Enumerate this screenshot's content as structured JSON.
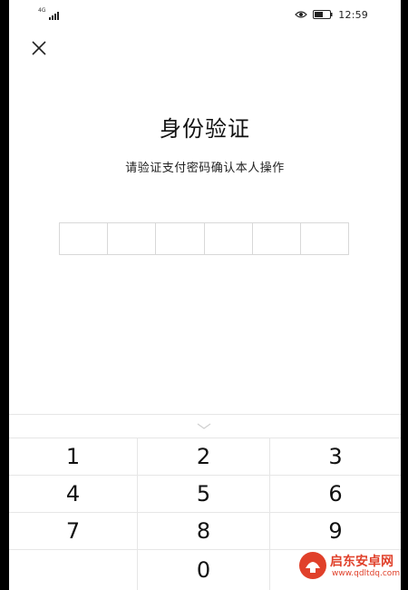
{
  "status_bar": {
    "network": "4G",
    "time": "12:59"
  },
  "header": {
    "close_icon": "close-icon"
  },
  "title": "身份验证",
  "subtitle": "请验证支付密码确认本人操作",
  "pin": {
    "length": 6
  },
  "keypad": {
    "collapse_icon": "chevron-down-icon",
    "keys": [
      "1",
      "2",
      "3",
      "4",
      "5",
      "6",
      "7",
      "8",
      "9",
      "",
      "0",
      ""
    ]
  },
  "watermark": {
    "name": "启东安卓网",
    "url": "www.qdltdq.com"
  },
  "colors": {
    "background": "#ffffff",
    "border": "#e6e6e6",
    "text": "#111111",
    "watermark": "#e0402a"
  }
}
